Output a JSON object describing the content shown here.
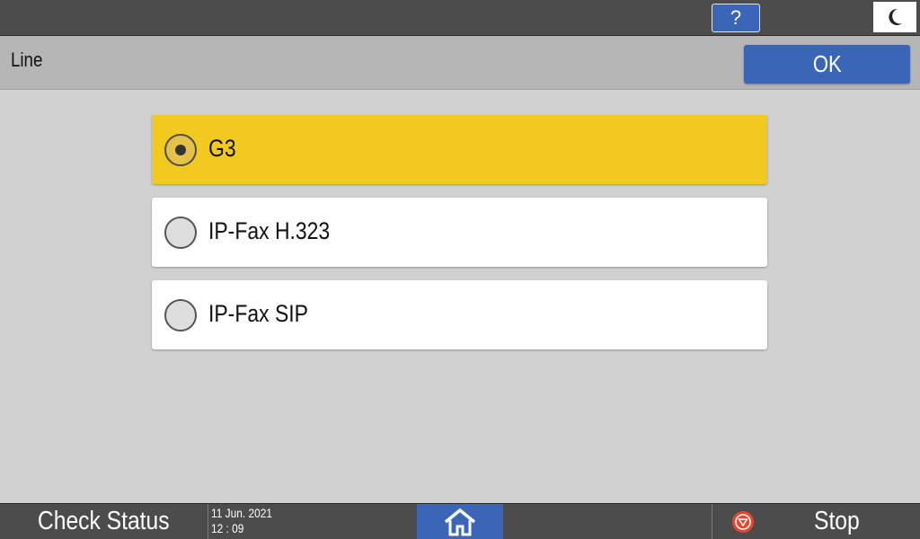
{
  "topbar": {
    "help_label": "?",
    "energy_icon": "moon-icon"
  },
  "header": {
    "title": "Line",
    "ok_label": "OK"
  },
  "options": [
    {
      "label": "G3",
      "selected": true
    },
    {
      "label": "IP-Fax H.323",
      "selected": false
    },
    {
      "label": "IP-Fax SIP",
      "selected": false
    }
  ],
  "bottombar": {
    "check_status_label": "Check Status",
    "date": "11 Jun. 2021",
    "time": "12 : 09",
    "home_icon": "home-icon",
    "stop_label": "Stop",
    "stop_icon": "stop-icon"
  },
  "colors": {
    "accent_blue": "#3b66b8",
    "selected_yellow": "#f2c91f",
    "stop_red": "#e8462b"
  }
}
